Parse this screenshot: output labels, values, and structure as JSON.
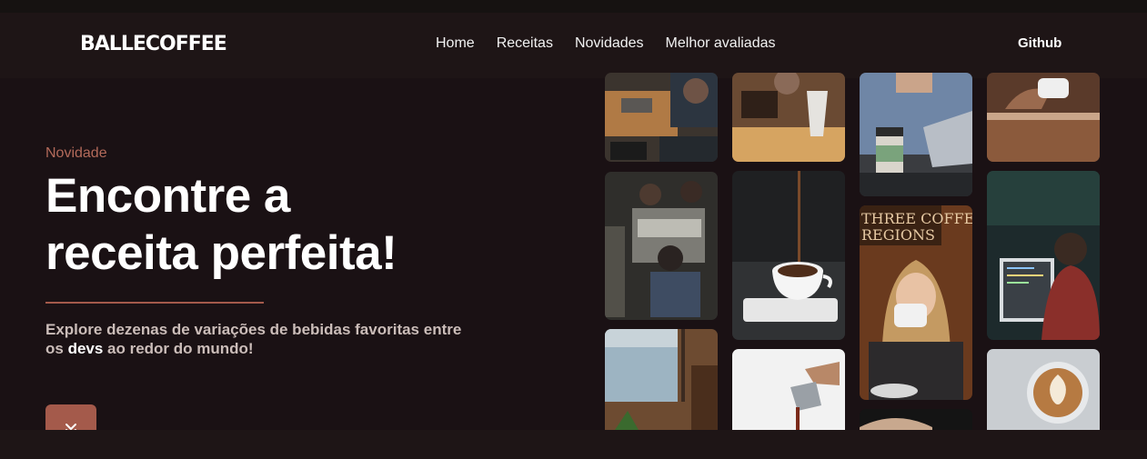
{
  "brand": {
    "logo": "BALLECOFFEE"
  },
  "nav": {
    "links": [
      "Home",
      "Receitas",
      "Novidades",
      "Melhor avaliadas"
    ],
    "github": "Github"
  },
  "hero": {
    "kicker": "Novidade",
    "headline_line1": "Encontre a",
    "headline_line2": "receita perfeita!",
    "subtitle_part1": "Explore dezenas de variações de bebidas favoritas entre os ",
    "subtitle_em": "devs",
    "subtitle_part2": " ao redor do mundo!"
  },
  "scroll_button": {
    "icon": "double-chevron-down-icon"
  },
  "gallery": {
    "photos": [
      "coffee-shop-laptops-photo",
      "barista-espresso-photo",
      "man-laptop-coffee-cup-photo",
      "hand-holding-cup-photo",
      "baristas-coffee-bar-photo",
      "coffee-pour-cup-photo",
      "woman-drinking-coffee-photo",
      "developer-monitor-photo",
      "window-seat-photo",
      "milk-pitcher-pour-photo",
      "latte-art-photo",
      "hands-coffee-photo"
    ]
  },
  "colors": {
    "background": "#1a1114",
    "navbar": "#1e1516",
    "accent": "#a45a4b",
    "kicker": "#b36a5a"
  }
}
